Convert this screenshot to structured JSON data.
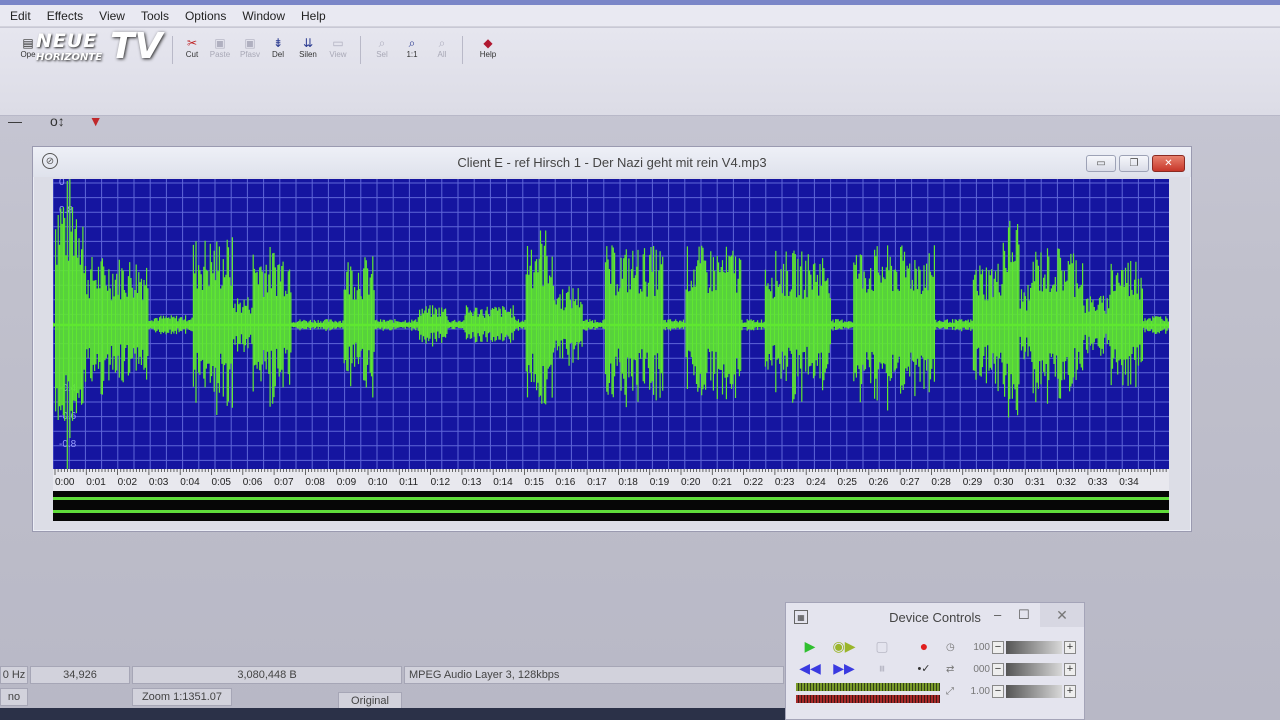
{
  "menu": [
    "Edit",
    "Effects",
    "View",
    "Tools",
    "Options",
    "Window",
    "Help"
  ],
  "toolbar": [
    {
      "label": "Ope",
      "icon": "open-icon",
      "enabled": true
    },
    {
      "label": "Cut",
      "icon": "cut-icon",
      "enabled": true
    },
    {
      "label": "Paste",
      "icon": "paste-icon",
      "enabled": false
    },
    {
      "label": "Pfasv",
      "icon": "paste-mix-icon",
      "enabled": false
    },
    {
      "label": "Del",
      "icon": "delete-icon",
      "enabled": true
    },
    {
      "label": "Silen",
      "icon": "silence-icon",
      "enabled": true
    },
    {
      "label": "View",
      "icon": "view-icon",
      "enabled": false
    },
    {
      "label": "Sel",
      "icon": "zoom-selection-icon",
      "enabled": false
    },
    {
      "label": "1:1",
      "icon": "zoom-1-1-icon",
      "enabled": true
    },
    {
      "label": "All",
      "icon": "zoom-all-icon",
      "enabled": false
    },
    {
      "label": "Help",
      "icon": "help-icon",
      "enabled": true
    }
  ],
  "logo": {
    "line1": "NEUE",
    "line2": "HORIZONTE",
    "tv": "TV"
  },
  "window": {
    "title": "Client E - ref Hirsch 1 - Der Nazi geht mit rein V4.mp3",
    "y_labels": [
      "0",
      "0.8",
      "-0.4",
      "-0.6",
      "-0.8"
    ],
    "time_labels": [
      "0:00",
      "0:01",
      "0:02",
      "0:03",
      "0:04",
      "0:05",
      "0:06",
      "0:07",
      "0:08",
      "0:09",
      "0:10",
      "0:11",
      "0:12",
      "0:13",
      "0:14",
      "0:15",
      "0:16",
      "0:17",
      "0:18",
      "0:19",
      "0:20",
      "0:21",
      "0:22",
      "0:23",
      "0:24",
      "0:25",
      "0:26",
      "0:27",
      "0:28",
      "0:29",
      "0:30",
      "0:31",
      "0:32",
      "0:33",
      "0:34"
    ],
    "wave_color": "#5fe830",
    "bg_color": "#1515a0",
    "grid_color": "#5f66d8"
  },
  "status": {
    "hz": "0 Hz",
    "mono": "no",
    "sample_count": "34,926",
    "bytes": "3,080,448 B",
    "zoom": "Zoom 1:1351.07",
    "format": "MPEG Audio Layer 3, 128kbps",
    "original": "Original"
  },
  "device_controls": {
    "title": "Device Controls",
    "vals": [
      "100",
      "000",
      "1.00"
    ]
  }
}
